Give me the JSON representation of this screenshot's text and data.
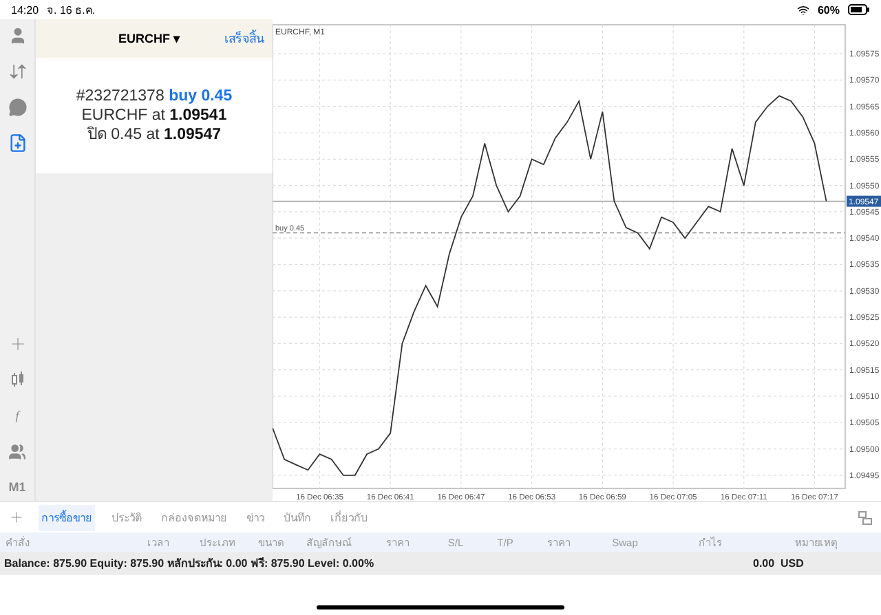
{
  "status_bar": {
    "time": "14:20",
    "date": "จ. 16 ธ.ค.",
    "battery": "60%"
  },
  "nav_icons": [
    {
      "selected": false
    },
    {
      "selected": false
    },
    {
      "selected": false
    },
    {
      "selected": true
    }
  ],
  "chart_tools": {
    "function_label": "f",
    "timeframe": "M1"
  },
  "order_panel": {
    "symbol": "EURCHF",
    "dropdown": "▾",
    "done": "เสร็จสิ้น",
    "ticket": "#232721378",
    "action": "buy 0.45",
    "open_label": "EURCHF at",
    "open_price": "1.09541",
    "close_line": "ปิด 0.45 at **1.09547**"
  },
  "chart": {
    "title": "EURCHF, M1",
    "chart_data": {
      "type": "line",
      "categories": [
        null,
        null,
        null,
        null,
        "16 Dec 06:35",
        null,
        null,
        null,
        null,
        null,
        "16 Dec 06:41",
        null,
        null,
        null,
        null,
        null,
        "16 Dec 06:47",
        null,
        null,
        null,
        null,
        null,
        "16 Dec 06:53",
        null,
        null,
        null,
        null,
        null,
        "16 Dec 06:59",
        null,
        null,
        null,
        null,
        null,
        "16 Dec 07:05",
        null,
        null,
        null,
        null,
        null,
        "16 Dec 07:11",
        null,
        null,
        null,
        null,
        null,
        "16 Dec 07:17",
        null
      ],
      "series": [
        {
          "color": "#333333",
          "values": [
            1.09504,
            1.09498,
            1.09497,
            1.09496,
            1.09499,
            1.09498,
            1.09495,
            1.09495,
            1.09499,
            1.095,
            1.09503,
            1.0952,
            1.09526,
            1.09531,
            1.09527,
            1.09537,
            1.09544,
            1.09548,
            1.09558,
            1.0955,
            1.09545,
            1.09548,
            1.09555,
            1.09554,
            1.09559,
            1.09562,
            1.09566,
            1.09555,
            1.09564,
            1.09547,
            1.09542,
            1.09541,
            1.09538,
            1.09544,
            1.09543,
            1.0954,
            1.09543,
            1.09546,
            1.09545,
            1.09557,
            1.0955,
            1.09562,
            1.09565,
            1.09567,
            1.09566,
            1.09563,
            1.09558,
            1.09547
          ]
        }
      ],
      "ylim": [
        1.094925,
        1.095805
      ],
      "grid": true,
      "ref_lines": [
        {
          "axis": "y",
          "value": 1.09547,
          "label": "1.09547"
        },
        {
          "axis": "y",
          "value": 1.09541,
          "label": "buy 0.45"
        }
      ],
      "yticks": [
        {
          "value": 1.09495,
          "label": "1.09495"
        },
        {
          "value": 1.095,
          "label": "1.09500"
        },
        {
          "value": 1.09505,
          "label": "1.09505"
        },
        {
          "value": 1.0951,
          "label": "1.09510"
        },
        {
          "value": 1.09515,
          "label": "1.09515"
        },
        {
          "value": 1.0952,
          "label": "1.09520"
        },
        {
          "value": 1.09525,
          "label": "1.09525"
        },
        {
          "value": 1.0953,
          "label": "1.09530"
        },
        {
          "value": 1.09535,
          "label": "1.09535"
        },
        {
          "value": 1.0954,
          "label": "1.09540"
        },
        {
          "value": 1.09545,
          "label": "1.09545"
        },
        {
          "value": 1.0955,
          "label": "1.09550"
        },
        {
          "value": 1.09555,
          "label": "1.09555"
        },
        {
          "value": 1.0956,
          "label": "1.09560"
        },
        {
          "value": 1.09565,
          "label": "1.09565"
        },
        {
          "value": 1.0957,
          "label": "1.09570"
        },
        {
          "value": 1.09575,
          "label": "1.09575"
        }
      ]
    }
  },
  "tabs": [
    {
      "label": "การซื้อขาย",
      "selected": true
    },
    {
      "label": "ประวัติ",
      "selected": false
    },
    {
      "label": "กล่องจดหมาย",
      "selected": false
    },
    {
      "label": "ข่าว",
      "selected": false
    },
    {
      "label": "บันทึก",
      "selected": false
    },
    {
      "label": "เกี่ยวกับ",
      "selected": false
    }
  ],
  "table": {
    "columns": [
      "คำสั่ง",
      "เวลา",
      "ประเภท",
      "ขนาด",
      "สัญลักษณ์",
      "ราคา",
      "S/L",
      "T/P",
      "ราคา",
      "Swap",
      "กำไร",
      "หมายเหตุ"
    ]
  },
  "summary": {
    "text": "Balance: 875.90 Equity: 875.90 หลักประกัน: 0.00 ฟรี: 875.90 Level: 0.00%",
    "profit": "0.00  USD"
  }
}
